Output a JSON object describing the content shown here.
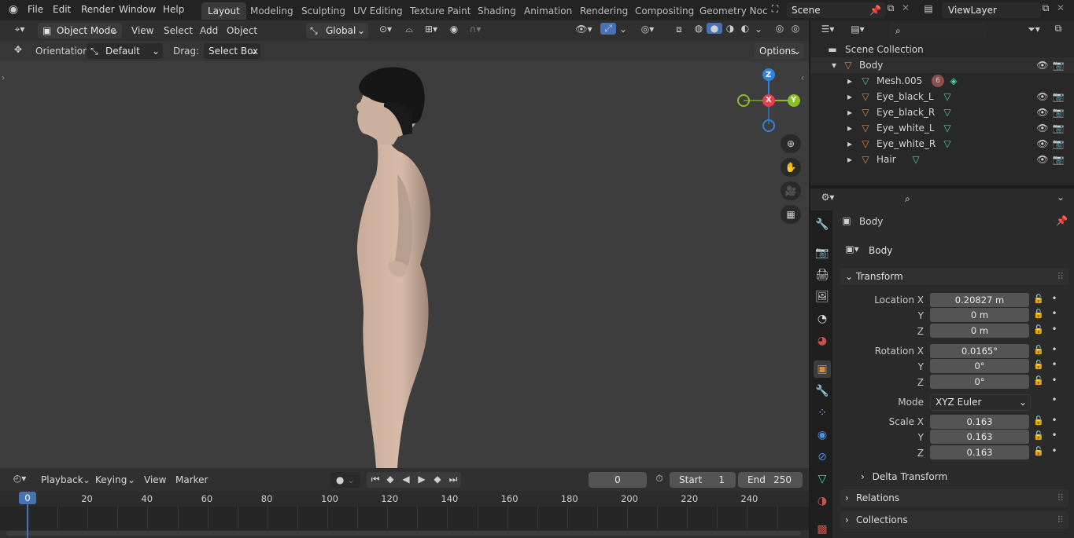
{
  "menu": {
    "file": "File",
    "edit": "Edit",
    "render": "Render",
    "window": "Window",
    "help": "Help"
  },
  "workspaces": [
    "Layout",
    "Modeling",
    "Sculpting",
    "UV Editing",
    "Texture Paint",
    "Shading",
    "Animation",
    "Rendering",
    "Compositing",
    "Geometry Noc"
  ],
  "scene": {
    "name": "Scene",
    "view_layer": "ViewLayer"
  },
  "viewport_header": {
    "mode": "Object Mode",
    "view": "View",
    "select": "Select",
    "add": "Add",
    "object": "Object",
    "transform_orientation": "Global"
  },
  "tool_header": {
    "orientation_label": "Orientation:",
    "orientation_value": "Default",
    "drag_label": "Drag:",
    "drag_value": "Select Box",
    "options": "Options"
  },
  "gizmo": {
    "x": "X",
    "y": "Y",
    "z": "Z"
  },
  "timeline": {
    "playback": "Playback",
    "keying": "Keying",
    "view": "View",
    "marker": "Marker",
    "current_frame": "0",
    "start_label": "Start",
    "start_value": "1",
    "end_label": "End",
    "end_value": "250",
    "ruler": [
      "0",
      "20",
      "40",
      "60",
      "80",
      "100",
      "120",
      "140",
      "160",
      "180",
      "200",
      "220",
      "240"
    ]
  },
  "outliner": {
    "root": "Scene Collection",
    "collection": "Body",
    "items": [
      {
        "name": "Mesh.005"
      },
      {
        "name": "Eye_black_L"
      },
      {
        "name": "Eye_black_R"
      },
      {
        "name": "Eye_white_L"
      },
      {
        "name": "Eye_white_R"
      },
      {
        "name": "Hair"
      }
    ],
    "mesh_badge": "6"
  },
  "properties": {
    "object_name": "Body",
    "data_name": "Body",
    "transform_title": "Transform",
    "location": {
      "label_x": "Location X",
      "label_y": "Y",
      "label_z": "Z",
      "x": "0.20827 m",
      "y": "0 m",
      "z": "0 m"
    },
    "rotation": {
      "label_x": "Rotation X",
      "label_y": "Y",
      "label_z": "Z",
      "x": "0.0165°",
      "y": "0°",
      "z": "0°"
    },
    "mode_label": "Mode",
    "mode_value": "XYZ Euler",
    "scale": {
      "label_x": "Scale X",
      "label_y": "Y",
      "label_z": "Z",
      "x": "0.163",
      "y": "0.163",
      "z": "0.163"
    },
    "delta_transform": "Delta Transform",
    "relations": "Relations",
    "collections": "Collections"
  },
  "colors": {
    "accent": "#4772b3",
    "x_axis": "#e83d4e",
    "y_axis": "#8bbf25",
    "z_axis": "#2f83e0",
    "orange": "#e08b3b"
  }
}
